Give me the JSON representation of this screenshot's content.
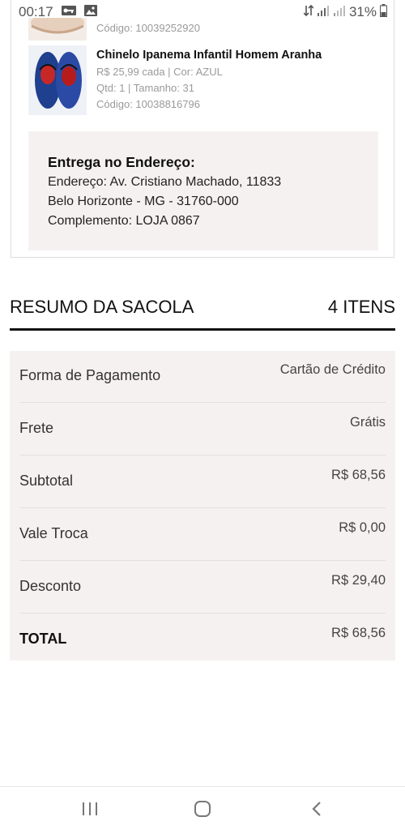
{
  "status": {
    "time": "00:17",
    "battery": "31%",
    "icons": [
      "key-icon",
      "image-icon",
      "data-arrows-icon",
      "signal-icon",
      "signal-icon",
      "battery-icon"
    ]
  },
  "products": [
    {
      "code": "Código: 10039252920"
    },
    {
      "name": "Chinelo Ipanema Infantil Homem Aranha",
      "price_color": "R$ 25,99 cada | Cor: AZUL",
      "qty_size": "Qtd: 1 | Tamanho: 31",
      "code": "Código: 10038816796"
    }
  ],
  "delivery": {
    "title": "Entrega no Endereço:",
    "address": "Endereço: Av. Cristiano Machado, 11833",
    "city": "Belo Horizonte - MG - 31760-000",
    "complement": "Complemento: LOJA 0867"
  },
  "summary": {
    "title": "RESUMO DA SACOLA",
    "count": "4 ITENS",
    "rows": [
      {
        "label": "Forma de Pagamento",
        "value": "Cartão de Crédito"
      },
      {
        "label": "Frete",
        "value": "Grátis"
      },
      {
        "label": "Subtotal",
        "value": "R$ 68,56"
      },
      {
        "label": "Vale Troca",
        "value": "R$ 0,00"
      },
      {
        "label": "Desconto",
        "value": "R$ 29,40"
      },
      {
        "label": "TOTAL",
        "value": "R$ 68,56"
      }
    ]
  },
  "colors": {
    "panel_bg": "#f6f1f1",
    "divider": "#111111",
    "muted_text": "#9a9a9a"
  },
  "nav": {
    "icons": [
      "recent-apps-icon",
      "home-icon",
      "back-icon"
    ]
  }
}
